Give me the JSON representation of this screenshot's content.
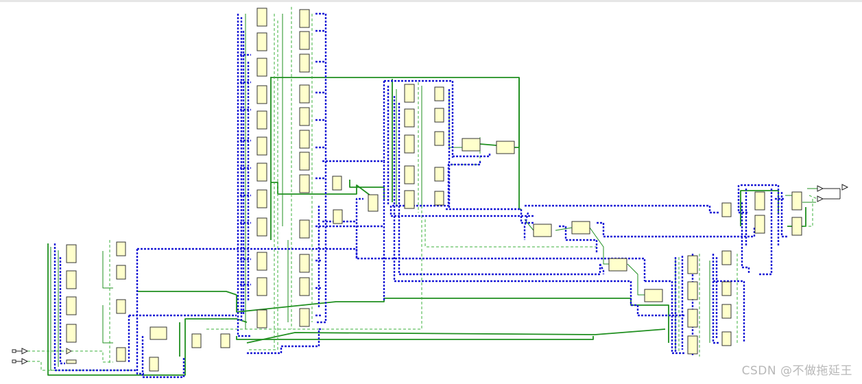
{
  "watermark": {
    "text": "CSDN @不做拖延王"
  },
  "colors": {
    "background": "#ffffff",
    "block_fill": "#ffffcc",
    "block_stroke": "#333333",
    "bus_wire": "#1a1ad6",
    "signal_wire": "#1f8f1f",
    "dashed_wire": "#3bb03b",
    "port": "#222222"
  },
  "diagram": {
    "type": "schematic-rtl-netlist",
    "input_ports": 2,
    "output_ports": 2
  }
}
